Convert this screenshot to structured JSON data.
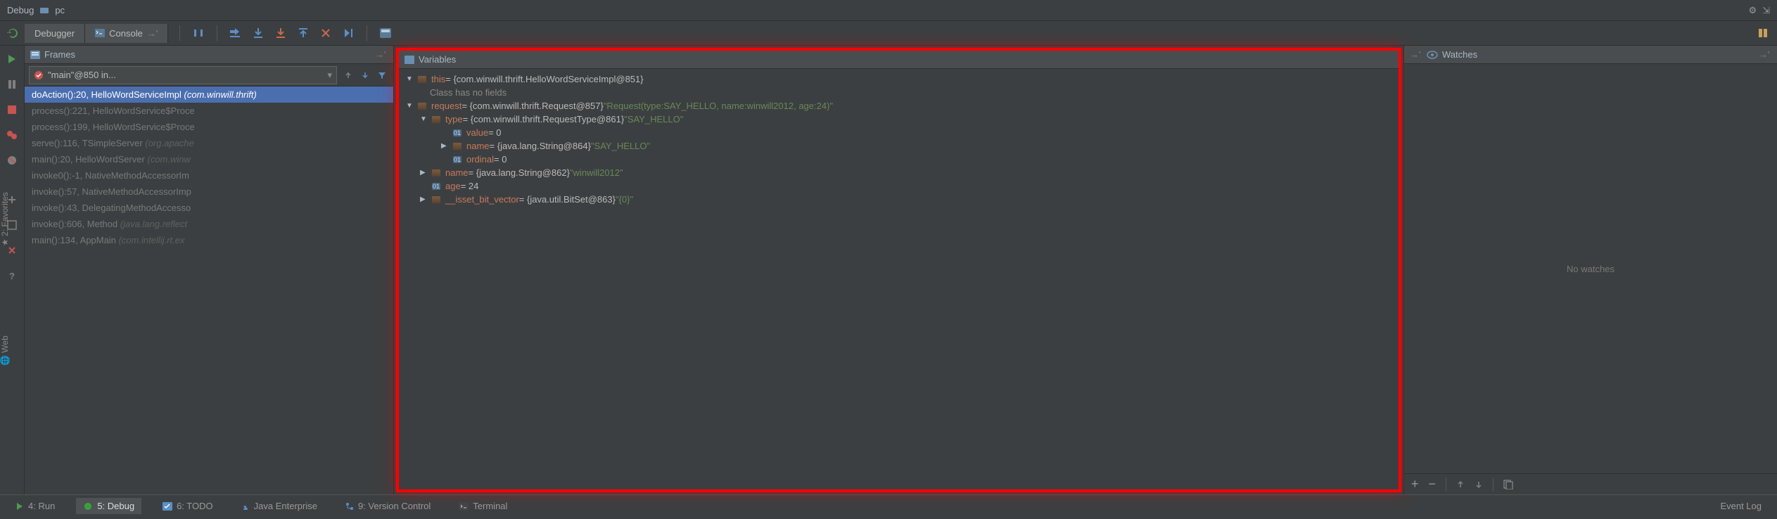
{
  "window": {
    "title": "Debug",
    "config": "pc"
  },
  "tabs": {
    "debugger": "Debugger",
    "console": "Console"
  },
  "frames": {
    "title": "Frames",
    "thread": "\"main\"@850 in...",
    "items": [
      {
        "method": "doAction():20, HelloWordServiceImpl",
        "pkg": "(com.winwill.thrift)",
        "active": true,
        "lib": false
      },
      {
        "method": "process():221, HelloWordService$Proce",
        "pkg": "",
        "active": false,
        "lib": false
      },
      {
        "method": "process():199, HelloWordService$Proce",
        "pkg": "",
        "active": false,
        "lib": false
      },
      {
        "method": "serve():116, TSimpleServer",
        "pkg": "(org.apache",
        "active": false,
        "lib": true
      },
      {
        "method": "main():20, HelloWordServer",
        "pkg": "(com.winw",
        "active": false,
        "lib": false
      },
      {
        "method": "invoke0():-1, NativeMethodAccessorIm",
        "pkg": "",
        "active": false,
        "lib": true
      },
      {
        "method": "invoke():57, NativeMethodAccessorImp",
        "pkg": "",
        "active": false,
        "lib": true
      },
      {
        "method": "invoke():43, DelegatingMethodAccesso",
        "pkg": "",
        "active": false,
        "lib": true
      },
      {
        "method": "invoke():606, Method",
        "pkg": "(java.lang.reflect",
        "active": false,
        "lib": true
      },
      {
        "method": "main():134, AppMain",
        "pkg": "(com.intellij.rt.ex",
        "active": false,
        "lib": true
      }
    ]
  },
  "variables": {
    "title": "Variables",
    "rows": [
      {
        "indent": 0,
        "arrow": "down",
        "icon": "field",
        "name": "this",
        "val": " = {com.winwill.thrift.HelloWordServiceImpl@851}"
      },
      {
        "indent": 1,
        "arrow": "",
        "icon": "",
        "name": "",
        "val_plain": "Class has no fields",
        "dull": true
      },
      {
        "indent": 0,
        "arrow": "down",
        "icon": "field",
        "name": "request",
        "val": " = {com.winwill.thrift.Request@857} ",
        "str": "\"Request(type:SAY_HELLO, name:winwill2012, age:24)\""
      },
      {
        "indent": 1,
        "arrow": "down",
        "icon": "field",
        "name": "type",
        "val": " = {com.winwill.thrift.RequestType@861} ",
        "str": "\"SAY_HELLO\""
      },
      {
        "indent": 2,
        "arrow": "",
        "icon": "prim",
        "name": "value",
        "val": " = 0"
      },
      {
        "indent": 2,
        "arrow": "right",
        "icon": "field",
        "name": "name",
        "val": " = {java.lang.String@864} ",
        "str": "\"SAY_HELLO\""
      },
      {
        "indent": 2,
        "arrow": "",
        "icon": "prim",
        "name": "ordinal",
        "val": " = 0"
      },
      {
        "indent": 1,
        "arrow": "right",
        "icon": "field",
        "name": "name",
        "val": " = {java.lang.String@862} ",
        "str": "\"winwill2012\""
      },
      {
        "indent": 1,
        "arrow": "",
        "icon": "prim",
        "name": "age",
        "val": " = 24"
      },
      {
        "indent": 1,
        "arrow": "right",
        "icon": "field",
        "name": "__isset_bit_vector",
        "val": " = {java.util.BitSet@863} ",
        "str": "\"{0}\""
      }
    ]
  },
  "watches": {
    "title": "Watches",
    "empty": "No watches"
  },
  "bottom": {
    "run": "4: Run",
    "debug": "5: Debug",
    "todo": "6: TODO",
    "java_ee": "Java Enterprise",
    "vcs": "9: Version Control",
    "terminal": "Terminal",
    "event_log": "Event Log"
  },
  "side": {
    "favorites": "2: Favorites",
    "web": "Web"
  }
}
